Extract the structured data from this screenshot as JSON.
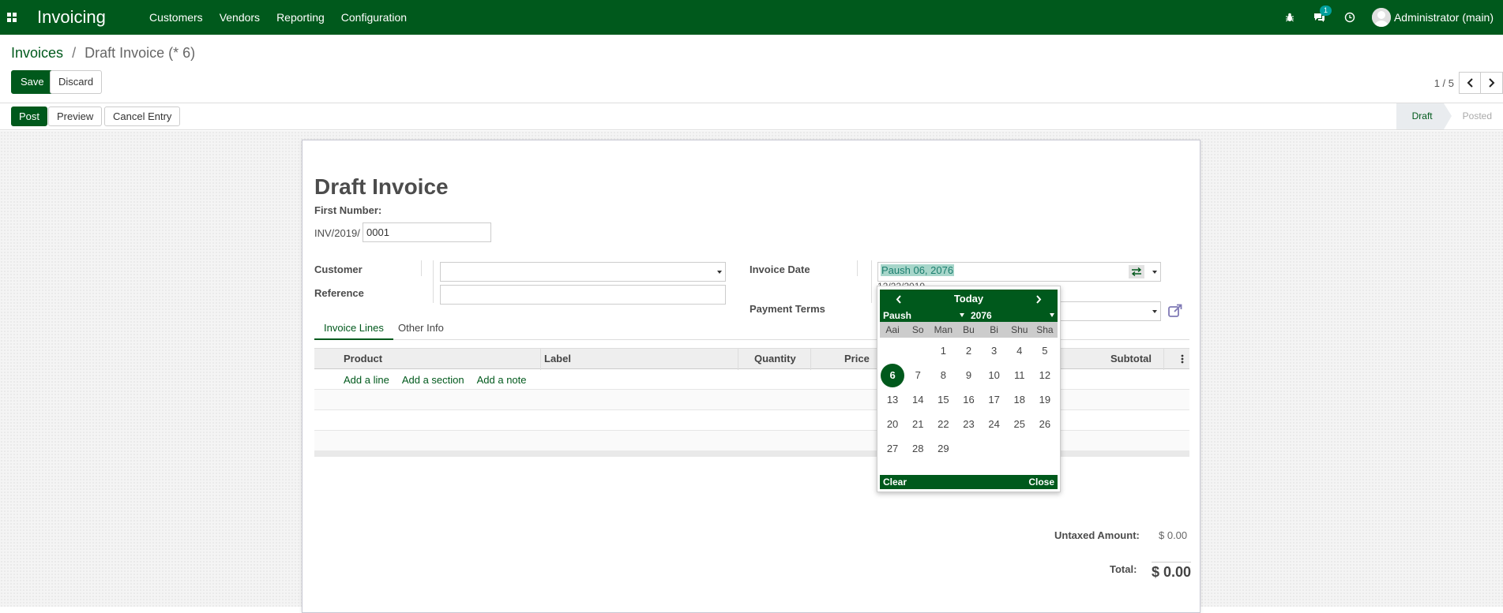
{
  "navbar": {
    "app_name": "Invoicing",
    "menu": [
      "Customers",
      "Vendors",
      "Reporting",
      "Configuration"
    ],
    "messages_count": "1",
    "user": "Administrator (main)",
    "bg_color": "#00591c"
  },
  "breadcrumb": {
    "parent": "Invoices",
    "separator": "/",
    "current": "Draft Invoice (* 6)"
  },
  "actions": {
    "save": "Save",
    "discard": "Discard"
  },
  "pager": {
    "value": "1 / 5"
  },
  "statusbar": {
    "buttons": {
      "post": "Post",
      "preview": "Preview",
      "cancel_entry": "Cancel Entry"
    },
    "steps": [
      "Draft",
      "Posted"
    ],
    "active_step": "Draft"
  },
  "form": {
    "title": "Draft Invoice",
    "first_number_label": "First Number:",
    "sequence_prefix": "INV/2019/",
    "sequence_value": "0001",
    "customer_label": "Customer",
    "customer_value": "",
    "reference_label": "Reference",
    "reference_value": "",
    "invoice_date_label": "Invoice Date",
    "invoice_date_value": "Paush 06, 2076",
    "invoice_date_secondary": "12/22/2019",
    "payment_terms_label": "Payment Terms",
    "payment_terms_value": ""
  },
  "tabs": [
    "Invoice Lines",
    "Other Info"
  ],
  "lines_table": {
    "columns": [
      "Product",
      "Label",
      "Quantity",
      "Price",
      "Subtotal"
    ],
    "add_links": [
      "Add a line",
      "Add a section",
      "Add a note"
    ]
  },
  "totals": {
    "untaxed_label": "Untaxed Amount:",
    "untaxed_value": "$ 0.00",
    "total_label": "Total:",
    "total_value": "$ 0.00"
  },
  "datepicker": {
    "today_label": "Today",
    "month": "Paush",
    "year": "2076",
    "weekdays": [
      "Aai",
      "So",
      "Man",
      "Bu",
      "Bi",
      "Shu",
      "Sha"
    ],
    "leading_blanks": 2,
    "days": [
      "1",
      "2",
      "3",
      "4",
      "5",
      "6",
      "7",
      "8",
      "9",
      "10",
      "11",
      "12",
      "13",
      "14",
      "15",
      "16",
      "17",
      "18",
      "19",
      "20",
      "21",
      "22",
      "23",
      "24",
      "25",
      "26",
      "27",
      "28",
      "29"
    ],
    "selected_day": "6",
    "clear_label": "Clear",
    "close_label": "Close"
  }
}
